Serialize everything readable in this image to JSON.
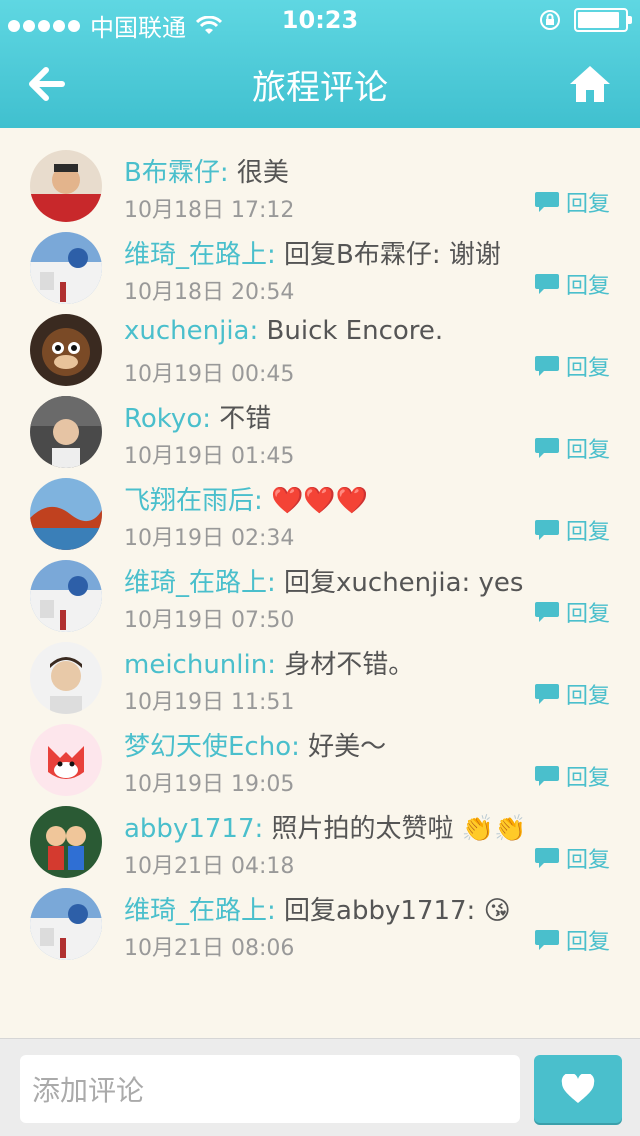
{
  "status_bar": {
    "carrier": "中国联通",
    "time": "10:23",
    "battery_level": 0.9
  },
  "header": {
    "title": "旅程评论",
    "back_icon": "back-arrow-icon",
    "home_icon": "home-icon"
  },
  "reply_label": "回复",
  "comments": [
    {
      "user": "B布霖仔:",
      "text": "很美",
      "time": "10月18日 17:12",
      "avatar": "avatar-man-red-shirt"
    },
    {
      "user": "维琦_在路上:",
      "text": "回复B布霖仔: 谢谢",
      "time": "10月18日 20:54",
      "avatar": "avatar-santorini"
    },
    {
      "user": "xuchenjia:",
      "text": "Buick Encore.",
      "time": "10月19日 00:45",
      "avatar": "avatar-monkey-toy"
    },
    {
      "user": "Rokyo:",
      "text": "不错",
      "time": "10月19日 01:45",
      "avatar": "avatar-man-car"
    },
    {
      "user": "飞翔在雨后:",
      "text": "",
      "emoji": "❤️❤️❤️",
      "time": "10月19日 02:34",
      "avatar": "avatar-autumn-lake"
    },
    {
      "user": "维琦_在路上:",
      "text": "回复xuchenjia: yes",
      "time": "10月19日 07:50",
      "avatar": "avatar-santorini"
    },
    {
      "user": "meichunlin:",
      "text": "身材不错。",
      "time": "10月19日 11:51",
      "avatar": "avatar-man-portrait"
    },
    {
      "user": "梦幻天使Echo:",
      "text": "好美～",
      "time": "10月19日 19:05",
      "avatar": "avatar-fox-cartoon"
    },
    {
      "user": "abby1717:",
      "text": "照片拍的太赞啦",
      "emoji": "👏👏",
      "time": "10月21日 04:18",
      "avatar": "avatar-dolls"
    },
    {
      "user": "维琦_在路上:",
      "text": "回复abby1717:",
      "emoji": "😘",
      "time": "10月21日 08:06",
      "avatar": "avatar-santorini"
    }
  ],
  "composer": {
    "placeholder": "添加评论",
    "send_icon": "heart-icon"
  }
}
